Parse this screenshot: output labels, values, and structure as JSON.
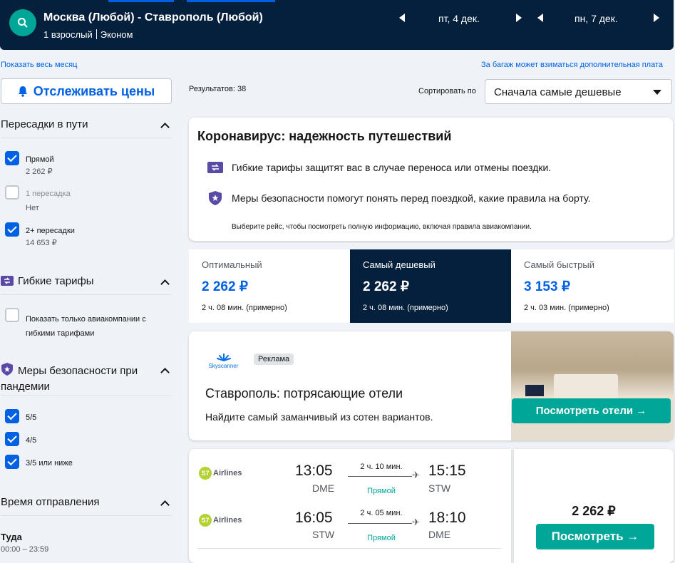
{
  "header": {
    "route": "Москва (Любой) - Ставрополь (Любой)",
    "passengers": "1 взрослый",
    "cabin": "Эконом",
    "depart_date": "пт, 4 дек.",
    "return_date": "пн, 7 дек."
  },
  "links": {
    "whole_month": "Показать весь месяц",
    "baggage": "За багаж может взиматься дополнительная плата"
  },
  "sidebar": {
    "track_prices": "Отслеживать цены",
    "stops": {
      "title": "Пересадки в пути",
      "options": [
        {
          "label": "Прямой",
          "price": "2 262 ₽",
          "checked": true
        },
        {
          "label": "1 пересадка",
          "price": "Нет",
          "checked": false
        },
        {
          "label": "2+ пересадки",
          "price": "14 653 ₽",
          "checked": true
        }
      ]
    },
    "flex": {
      "title": "Гибкие тарифы",
      "option": "Показать только авиакомпании с гибкими тарифами"
    },
    "safety": {
      "title": "Меры безопасности при пандемии",
      "options": [
        "5/5",
        "4/5",
        "3/5 или ниже"
      ]
    },
    "departure": {
      "title": "Время отправления",
      "sub": "Туда",
      "range": "00:00 – 23:59"
    }
  },
  "main": {
    "results": "Результатов: 38",
    "sort_label": "Сортировать по",
    "sort_value": "Сначала самые дешевые",
    "covid": {
      "title": "Коронавирус: надежность путешествий",
      "line1": "Гибкие тарифы защитят вас в случае переноса или отмены поездки.",
      "line2": "Меры безопасности помогут понять перед поездкой, какие правила на борту.",
      "footer": "Выберите рейс, чтобы посмотреть полную информацию, включая правила авиакомпании."
    },
    "tabs": [
      {
        "label": "Оптимальный",
        "price": "2 262 ₽",
        "duration": "2 ч. 08 мин. (примерно)"
      },
      {
        "label": "Самый дешевый",
        "price": "2 262 ₽",
        "duration": "2 ч. 08 мин. (примерно)"
      },
      {
        "label": "Самый быстрый",
        "price": "3 153 ₽",
        "duration": "2 ч. 03 мин. (примерно)"
      }
    ],
    "ad": {
      "brand": "Skyscanner",
      "badge": "Реклама",
      "title": "Ставрополь: потрясающие отели",
      "subtitle": "Найдите самый заманчивый из сотен вариантов.",
      "button": "Посмотреть отели →"
    },
    "flight": {
      "legs": [
        {
          "airline": "Airlines",
          "dep_time": "13:05",
          "dep_code": "DME",
          "duration": "2 ч. 10 мин.",
          "stops": "Прямой",
          "arr_time": "15:15",
          "arr_code": "STW"
        },
        {
          "airline": "Airlines",
          "dep_time": "16:05",
          "dep_code": "STW",
          "duration": "2 ч. 05 мин.",
          "stops": "Прямой",
          "arr_time": "18:10",
          "arr_code": "DME"
        }
      ],
      "price": "2 262 ₽",
      "button": "Посмотреть →"
    }
  }
}
